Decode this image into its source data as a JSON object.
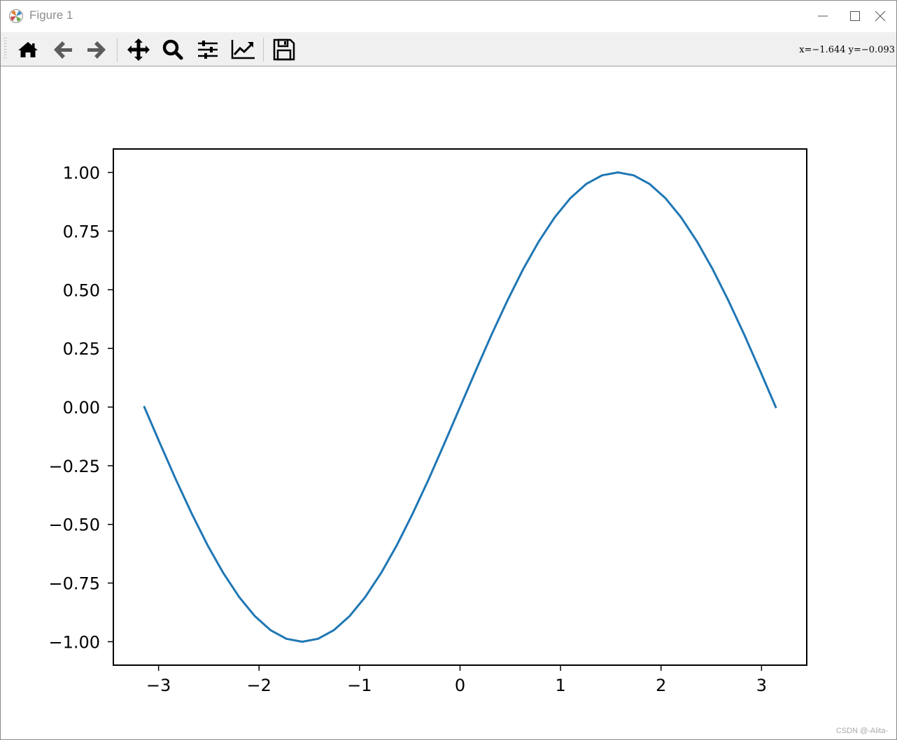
{
  "window": {
    "title": "Figure 1"
  },
  "toolbar": {
    "buttons": [
      {
        "name": "home-button",
        "icon": "home-icon"
      },
      {
        "name": "back-button",
        "icon": "arrow-left-icon"
      },
      {
        "name": "forward-button",
        "icon": "arrow-right-icon"
      },
      {
        "name": "pan-button",
        "icon": "move-icon"
      },
      {
        "name": "zoom-button",
        "icon": "magnifier-icon"
      },
      {
        "name": "subplots-button",
        "icon": "sliders-icon"
      },
      {
        "name": "edit-axes-button",
        "icon": "line-chart-icon"
      },
      {
        "name": "save-button",
        "icon": "floppy-disk-icon"
      }
    ],
    "coords": "x=−1.644 y=−0.093"
  },
  "chart_data": {
    "type": "line",
    "title": "",
    "xlabel": "",
    "ylabel": "",
    "xlim": [
      -3.45,
      3.45
    ],
    "ylim": [
      -1.1,
      1.1
    ],
    "x_ticks": [
      -3,
      -2,
      -1,
      0,
      1,
      2,
      3
    ],
    "x_tick_labels": [
      "−3",
      "−2",
      "−1",
      "0",
      "1",
      "2",
      "3"
    ],
    "y_ticks": [
      1.0,
      0.75,
      0.5,
      0.25,
      0.0,
      -0.25,
      -0.5,
      -0.75,
      -1.0
    ],
    "y_tick_labels": [
      "1.00",
      "0.75",
      "0.50",
      "0.25",
      "0.00",
      "−0.25",
      "−0.50",
      "−0.75",
      "−1.00"
    ],
    "grid": false,
    "series": [
      {
        "color": "#1f77b4",
        "x": [
          -3.1416,
          -2.9845,
          -2.8274,
          -2.6704,
          -2.5133,
          -2.3562,
          -2.1991,
          -2.042,
          -1.885,
          -1.7279,
          -1.5708,
          -1.4137,
          -1.2566,
          -1.0996,
          -0.9425,
          -0.7854,
          -0.6283,
          -0.4712,
          -0.3142,
          -0.1571,
          0.0,
          0.1571,
          0.3142,
          0.4712,
          0.6283,
          0.7854,
          0.9425,
          1.0996,
          1.2566,
          1.4137,
          1.5708,
          1.7279,
          1.885,
          2.042,
          2.1991,
          2.3562,
          2.5133,
          2.6704,
          2.8274,
          2.9845,
          3.1416
        ],
        "y": [
          0.0,
          -0.1564,
          -0.309,
          -0.454,
          -0.5878,
          -0.7071,
          -0.809,
          -0.891,
          -0.9511,
          -0.9877,
          -1.0,
          -0.9877,
          -0.9511,
          -0.891,
          -0.809,
          -0.7071,
          -0.5878,
          -0.454,
          -0.309,
          -0.1564,
          0.0,
          0.1564,
          0.309,
          0.454,
          0.5878,
          0.7071,
          0.809,
          0.891,
          0.9511,
          0.9877,
          1.0,
          0.9877,
          0.9511,
          0.891,
          0.809,
          0.7071,
          0.5878,
          0.454,
          0.309,
          0.1564,
          0.0
        ]
      }
    ]
  },
  "watermark": "CSDN @-Alita-"
}
